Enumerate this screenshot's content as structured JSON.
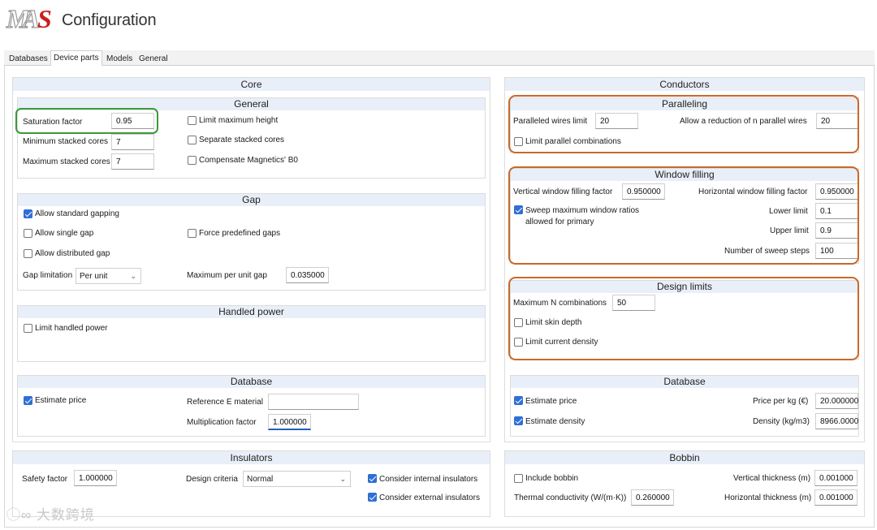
{
  "app": {
    "title": "Configuration",
    "logo": "MAS logo",
    "brand_colors": {
      "red": "#c82020",
      "gray": "#7a7a7a"
    }
  },
  "tabs": [
    "Databases",
    "Device parts",
    "Models",
    "General"
  ],
  "core": {
    "title": "Core",
    "general": {
      "title": "General",
      "saturation_factor": {
        "label": "Saturation factor",
        "value": "0.95"
      },
      "min_stacked": {
        "label": "Minimum stacked cores",
        "value": "7"
      },
      "max_stacked": {
        "label": "Maximum stacked cores",
        "value": "7"
      },
      "limit_max_height": {
        "label": "Limit maximum height",
        "checked": false
      },
      "separate_stacked": {
        "label": "Separate stacked cores",
        "checked": false
      },
      "compensate_b0": {
        "label": "Compensate Magnetics' B0",
        "checked": false
      }
    },
    "gap": {
      "title": "Gap",
      "allow_standard": {
        "label": "Allow standard gapping",
        "checked": true
      },
      "allow_single": {
        "label": "Allow single gap",
        "checked": false
      },
      "force_predefined": {
        "label": "Force predefined gaps",
        "checked": false
      },
      "allow_distributed": {
        "label": "Allow distributed gap",
        "checked": false
      },
      "gap_limitation": {
        "label": "Gap limitation",
        "value": "Per unit"
      },
      "max_per_unit": {
        "label": "Maximum per unit gap",
        "value": "0.035000"
      }
    },
    "handled_power": {
      "title": "Handled power",
      "limit": {
        "label": "Limit handled power",
        "checked": false
      }
    },
    "database": {
      "title": "Database",
      "estimate_price": {
        "label": "Estimate price",
        "checked": true
      },
      "reference_material": {
        "label": "Reference E material",
        "value": ""
      },
      "multiplication": {
        "label": "Multiplication factor",
        "value": "1.000000"
      }
    }
  },
  "insulators": {
    "title": "Insulators",
    "safety_factor": {
      "label": "Safety factor",
      "value": "1.000000"
    },
    "design_criteria": {
      "label": "Design criteria",
      "value": "Normal"
    },
    "consider_internal": {
      "label": "Consider internal insulators",
      "checked": true
    },
    "consider_external": {
      "label": "Consider external insulators",
      "checked": true
    }
  },
  "conductors": {
    "title": "Conductors",
    "paralleling": {
      "title": "Paralleling",
      "wires_limit": {
        "label": "Paralleled wires limit",
        "value": "20"
      },
      "reduction": {
        "label": "Allow a reduction of n parallel wires",
        "value": "20"
      },
      "limit_combinations": {
        "label": "Limit parallel combinations",
        "checked": false
      }
    },
    "window_filling": {
      "title": "Window filling",
      "vertical": {
        "label": "Vertical window filling factor",
        "value": "0.950000"
      },
      "horizontal": {
        "label": "Horizontal window filling factor",
        "value": "0.950000"
      },
      "sweep": {
        "label_line1": "Sweep maximum window ratios",
        "label_line2": "allowed for primary",
        "checked": true
      },
      "lower": {
        "label": "Lower limit",
        "value": "0.1"
      },
      "upper": {
        "label": "Upper limit",
        "value": "0.9"
      },
      "steps": {
        "label": "Number of sweep steps",
        "value": "100"
      }
    },
    "design_limits": {
      "title": "Design limits",
      "max_n": {
        "label": "Maximum N combinations",
        "value": "50"
      },
      "skin_depth": {
        "label": "Limit skin depth",
        "checked": false
      },
      "current_density": {
        "label": "Limit current density",
        "checked": false
      }
    },
    "database": {
      "title": "Database",
      "estimate_price": {
        "label": "Estimate price",
        "checked": true
      },
      "estimate_density": {
        "label": "Estimate density",
        "checked": true
      },
      "price_per_kg": {
        "label": "Price per kg (€)",
        "value": "20.000000"
      },
      "density": {
        "label": "Density (kg/m3)",
        "value": "8966.0000"
      }
    }
  },
  "bobbin": {
    "title": "Bobbin",
    "include": {
      "label": "Include bobbin",
      "checked": false
    },
    "thermal": {
      "label": "Thermal conductivity (W/(m·K))",
      "value": "0.260000"
    },
    "vertical_thickness": {
      "label": "Vertical thickness (m)",
      "value": "0.001000"
    },
    "horizontal_thickness": {
      "label": "Horizontal thickness (m)",
      "value": "0.001000"
    }
  },
  "watermark": "大数跨境"
}
